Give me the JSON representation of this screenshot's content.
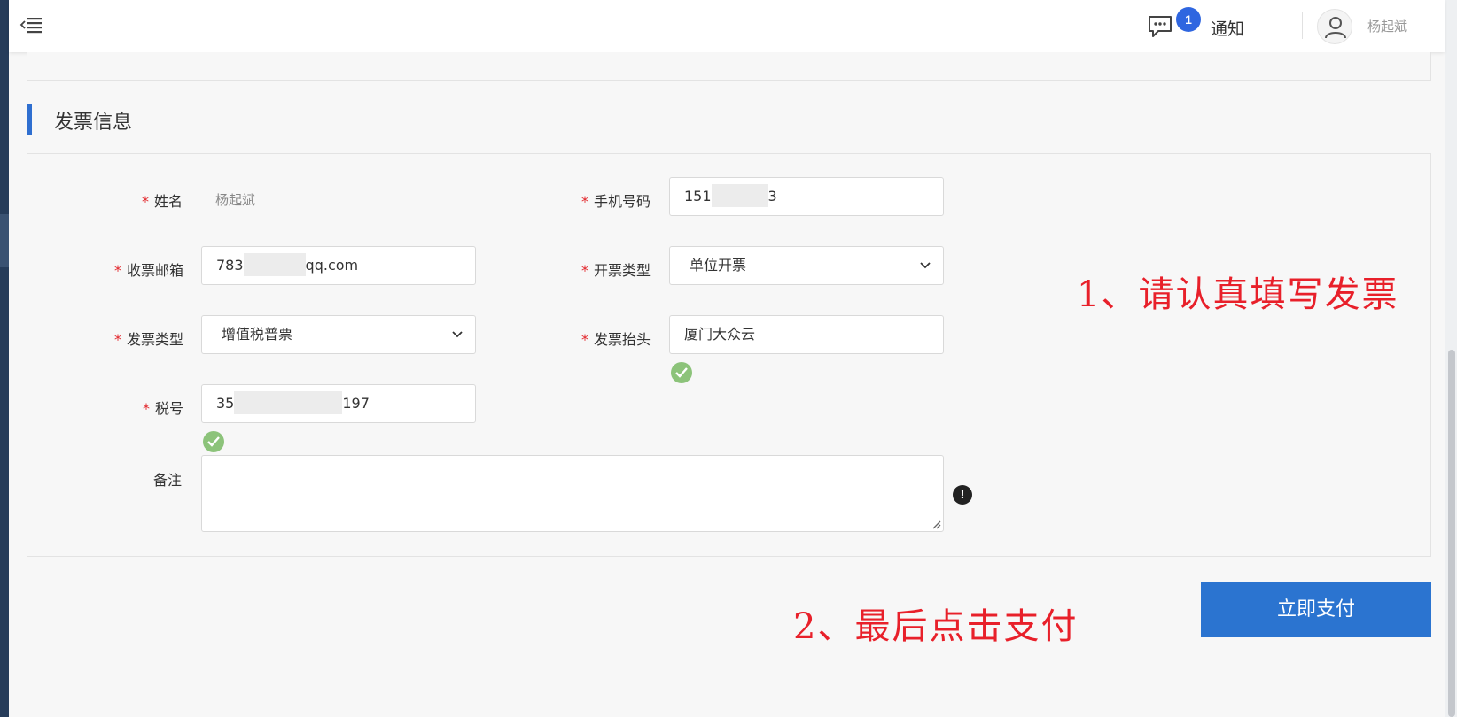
{
  "header": {
    "notification_count": "1",
    "notification_label": "通知",
    "user_name": "杨起斌"
  },
  "section": {
    "title": "发票信息"
  },
  "form": {
    "name": {
      "label": "姓名",
      "value": "杨起斌"
    },
    "phone": {
      "label": "手机号码",
      "value_prefix": "151",
      "value_suffix": "3"
    },
    "email": {
      "label": "收票邮箱",
      "value_prefix": "783",
      "value_suffix": "qq.com"
    },
    "issue_type": {
      "label": "开票类型",
      "value": "单位开票"
    },
    "invoice_type": {
      "label": "发票类型",
      "value": "增值税普票"
    },
    "invoice_header": {
      "label": "发票抬头",
      "value": "厦门大众云"
    },
    "tax_id": {
      "label": "税号",
      "value_prefix": "35",
      "value_suffix": "197"
    },
    "remark": {
      "label": "备注",
      "value": ""
    }
  },
  "annotations": {
    "step1": "1、请认真填写发票",
    "step2": "2、最后点击支付"
  },
  "actions": {
    "pay_label": "立即支付"
  },
  "colors": {
    "accent": "#2b74d0",
    "required": "#e2262b",
    "annotation": "#e8202a",
    "valid": "#8cc37a"
  }
}
